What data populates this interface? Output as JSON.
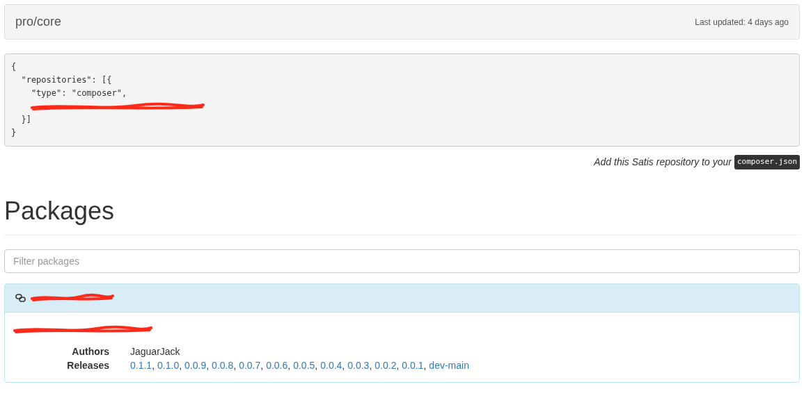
{
  "header": {
    "title": "pro/core",
    "last_updated": "Last updated: 4 days ago"
  },
  "code_block": {
    "lines": [
      {
        "kind": "code",
        "text": "{"
      },
      {
        "kind": "code",
        "text": "  \"repositories\": [{"
      },
      {
        "kind": "code",
        "text": "    \"type\": \"composer\","
      },
      {
        "kind": "redaction"
      },
      {
        "kind": "code",
        "text": "  }]"
      },
      {
        "kind": "code",
        "text": "}"
      }
    ]
  },
  "hint": {
    "text": "Add this Satis repository to your",
    "code": "composer.json"
  },
  "heading": "Packages",
  "filter": {
    "placeholder": "Filter packages"
  },
  "packages": [
    {
      "name_redacted": true,
      "description_redacted": true,
      "fields": [
        {
          "label": "Authors",
          "kind": "text",
          "values": [
            "JaguarJack"
          ]
        },
        {
          "label": "Releases",
          "kind": "links",
          "separator": ",",
          "values": [
            "0.1.1",
            "0.1.0",
            "0.0.9",
            "0.0.8",
            "0.0.7",
            "0.0.6",
            "0.0.5",
            "0.0.4",
            "0.0.3",
            "0.0.2",
            "0.0.1",
            "dev-main"
          ]
        }
      ]
    }
  ]
}
